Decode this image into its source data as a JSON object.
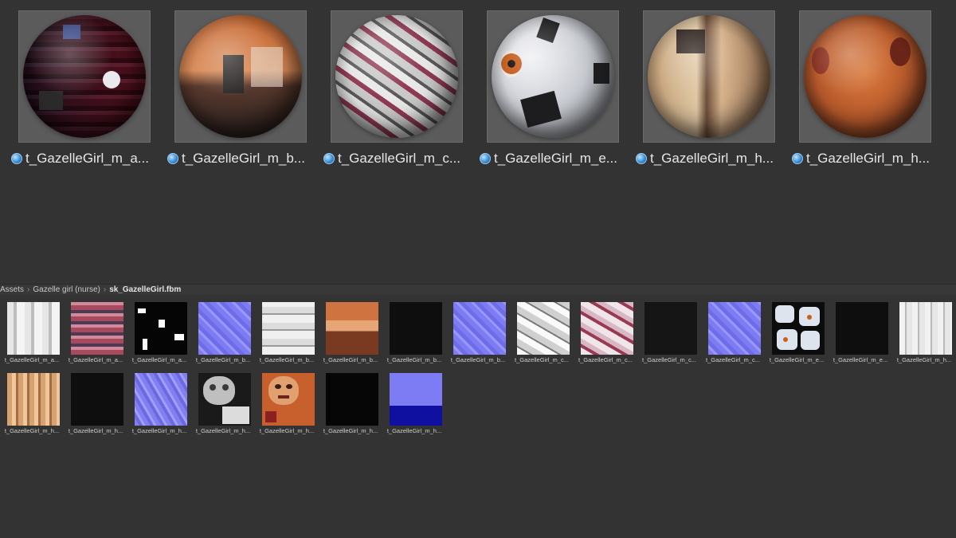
{
  "materials": [
    {
      "label": "t_GazelleGirl_m_a...",
      "icon": "material-icon"
    },
    {
      "label": "t_GazelleGirl_m_b...",
      "icon": "material-icon"
    },
    {
      "label": "t_GazelleGirl_m_c...",
      "icon": "material-icon"
    },
    {
      "label": "t_GazelleGirl_m_e...",
      "icon": "material-icon"
    },
    {
      "label": "t_GazelleGirl_m_h...",
      "icon": "material-icon"
    },
    {
      "label": "t_GazelleGirl_m_h...",
      "icon": "material-icon"
    }
  ],
  "breadcrumb": {
    "items": [
      "Assets",
      "Gazelle girl (nurse)",
      "sk_GazelleGirl.fbm"
    ],
    "separator": "›"
  },
  "textures_row1": [
    "t_GazelleGirl_m_a...",
    "t_GazelleGirl_m_a...",
    "t_GazelleGirl_m_a...",
    "t_GazelleGirl_m_b...",
    "t_GazelleGirl_m_b...",
    "t_GazelleGirl_m_b...",
    "t_GazelleGirl_m_b...",
    "t_GazelleGirl_m_b...",
    "t_GazelleGirl_m_c...",
    "t_GazelleGirl_m_c...",
    "t_GazelleGirl_m_c...",
    "t_GazelleGirl_m_c...",
    "t_GazelleGirl_m_e...",
    "t_GazelleGirl_m_e...",
    "t_GazelleGirl_m_h..."
  ],
  "textures_row2": [
    "t_GazelleGirl_m_h...",
    "t_GazelleGirl_m_h...",
    "t_GazelleGirl_m_h...",
    "t_GazelleGirl_m_h...",
    "t_GazelleGirl_m_h...",
    "t_GazelleGirl_m_h...",
    "t_GazelleGirl_m_h..."
  ],
  "colors": {
    "background": "#333333",
    "breadcrumb_bg": "#383838",
    "preview_frame": "#5b5b5b"
  }
}
